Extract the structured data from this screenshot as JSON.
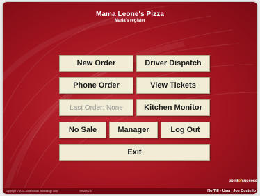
{
  "header": {
    "title": "Mama Leone's Pizza",
    "subtitle": "Maria's register"
  },
  "buttons": {
    "new_order": "New Order",
    "driver_dispatch": "Driver Dispatch",
    "phone_order": "Phone Order",
    "view_tickets": "View Tickets",
    "last_order": "Last Order: None",
    "kitchen_monitor": "Kitchen Monitor",
    "no_sale": "No Sale",
    "manager": "Manager",
    "log_out": "Log Out",
    "exit": "Exit"
  },
  "brand": {
    "name_left": "point",
    "separator": "of",
    "name_right": "success"
  },
  "footer": {
    "copyright": "Copyright © 2002-2005 Mosaic Technology Corp",
    "version": "Version 2.5",
    "status": "No Till - User: Joe Costello"
  },
  "colors": {
    "background": "#a1141f",
    "button": "#f1ecd6",
    "accent": "#f3c34a"
  }
}
